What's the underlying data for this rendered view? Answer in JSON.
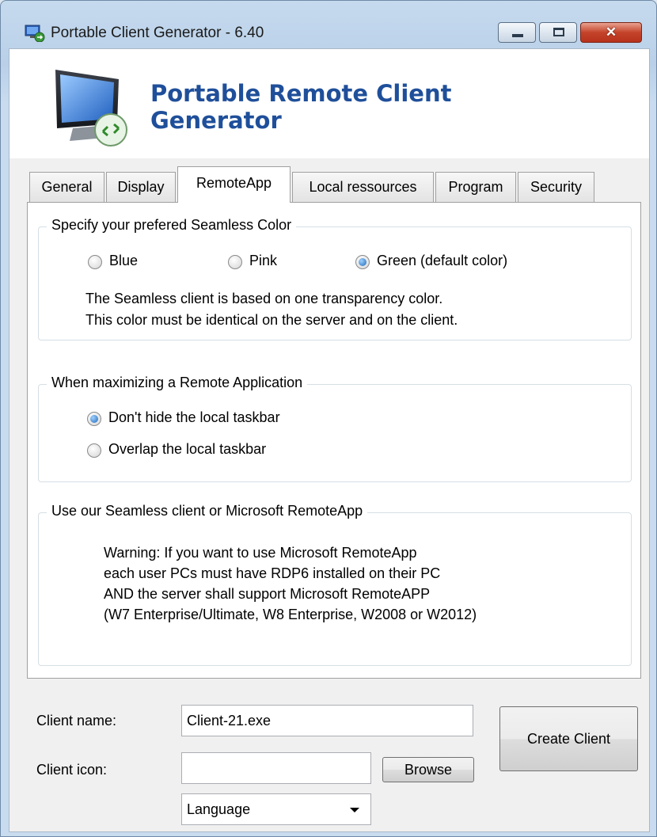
{
  "window": {
    "title": "Portable Client Generator - 6.40",
    "close_glyph": "✕"
  },
  "header": {
    "line1": "Portable Remote Client",
    "line2": "Generator"
  },
  "tabs": [
    {
      "label": "General",
      "active": false
    },
    {
      "label": "Display",
      "active": false
    },
    {
      "label": "RemoteApp",
      "active": true
    },
    {
      "label": "Local ressources",
      "active": false
    },
    {
      "label": "Program",
      "active": false
    },
    {
      "label": "Security",
      "active": false
    }
  ],
  "seamless_color": {
    "legend": "Specify your prefered Seamless Color",
    "options": [
      {
        "label": "Blue",
        "checked": false
      },
      {
        "label": "Pink",
        "checked": false
      },
      {
        "label": "Green (default color)",
        "checked": true
      }
    ],
    "note_line1": "The Seamless client is based on one transparency color.",
    "note_line2": "This color must be identical on the server and on the client."
  },
  "maximize": {
    "legend": "When maximizing a Remote Application",
    "options": [
      {
        "label": "Don't hide the local taskbar",
        "checked": true
      },
      {
        "label": "Overlap the local taskbar",
        "checked": false
      }
    ]
  },
  "client_type": {
    "legend": "Use our Seamless client or Microsoft RemoteApp",
    "lines": [
      "Warning: If you want to use Microsoft RemoteApp",
      "each user PCs must have RDP6 installed on their PC",
      "AND the server shall support Microsoft RemoteAPP",
      "(W7 Enterprise/Ultimate, W8 Enterprise, W2008 or W2012)"
    ]
  },
  "form": {
    "client_name_label": "Client name:",
    "client_name_value": "Client-21.exe",
    "client_icon_label": "Client icon:",
    "client_icon_value": "",
    "browse_label": "Browse",
    "create_label": "Create Client",
    "language_selected": "Language"
  },
  "icons": {
    "app": "remote-desktop-icon",
    "header": "monitor-remote-icon"
  },
  "colors": {
    "brand": "#1f4f9a",
    "close_button": "#c4432a"
  }
}
